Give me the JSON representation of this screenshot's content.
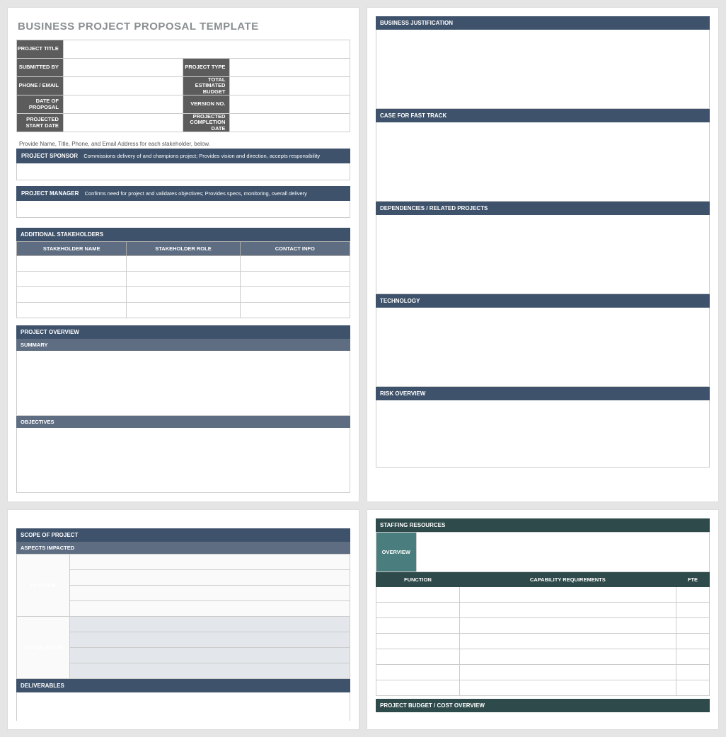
{
  "title": "BUSINESS PROJECT PROPOSAL TEMPLATE",
  "info": {
    "project_title": "PROJECT TITLE",
    "submitted_by": "SUBMITTED BY",
    "project_type": "PROJECT TYPE",
    "phone_email": "PHONE / EMAIL",
    "total_budget": "TOTAL ESTIMATED BUDGET",
    "date_of_proposal": "DATE OF PROPOSAL",
    "version_no": "VERSION NO.",
    "projected_start": "PROJECTED START DATE",
    "projected_completion": "PROJECTED COMPLETION DATE"
  },
  "note": "Provide Name, Title, Phone, and Email Address for each stakeholder, below.",
  "sponsor": {
    "label": "PROJECT SPONSOR",
    "desc": "Commissions delivery of and champions project; Provides vision and direction, accepts responsibility"
  },
  "manager": {
    "label": "PROJECT MANAGER",
    "desc": "Confirms need for project and validates objectives; Provides specs, monitoring, overall delivery"
  },
  "stakeholders": {
    "header": "ADDITIONAL STAKEHOLDERS",
    "col1": "STAKEHOLDER NAME",
    "col2": "STAKEHOLDER ROLE",
    "col3": "CONTACT INFO"
  },
  "overview": {
    "header": "PROJECT OVERVIEW",
    "summary": "SUMMARY",
    "objectives": "OBJECTIVES"
  },
  "p2": {
    "biz_just": "BUSINESS JUSTIFICATION",
    "fast_track": "CASE FOR FAST TRACK",
    "dependencies": "DEPENDENCIES / RELATED PROJECTS",
    "technology": "TECHNOLOGY",
    "risk": "RISK OVERVIEW"
  },
  "p3": {
    "scope": "SCOPE OF PROJECT",
    "aspects": "ASPECTS IMPACTED",
    "in_scope": "IN SCOPE",
    "out_scope": "OUT OF SCOPE",
    "deliverables": "DELIVERABLES"
  },
  "p4": {
    "staffing": "STAFFING RESOURCES",
    "overview": "OVERVIEW",
    "function": "FUNCTION",
    "capability": "CAPABILITY REQUIREMENTS",
    "fte": "FTE",
    "budget": "PROJECT BUDGET / COST OVERVIEW"
  }
}
